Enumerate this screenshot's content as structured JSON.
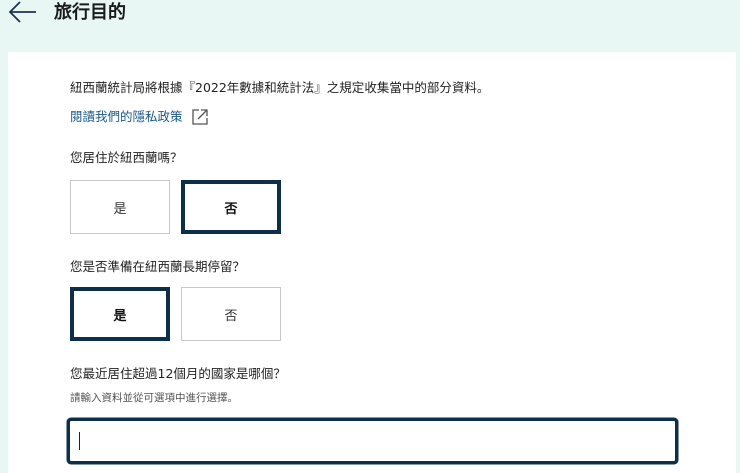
{
  "header": {
    "title": "旅行目的",
    "back_icon": "arrow-left-icon"
  },
  "form": {
    "notice": "紐西蘭統計局將根據『2022年數據和統計法』之規定收集當中的部分資料。",
    "privacy_link": {
      "label": "閱讀我們的隱私政策",
      "icon": "external-link-icon"
    },
    "questions": [
      {
        "label": "您居住於紐西蘭嗎？",
        "options": [
          "是",
          "否"
        ],
        "selected": "否"
      },
      {
        "label": "您是否準備在紐西蘭長期停留？",
        "options": [
          "是",
          "否"
        ],
        "selected": "是"
      }
    ],
    "country_question": {
      "label": "您最近居住超過12個月的國家是哪個？",
      "hint": "請輸入資料並從可選項中進行選擇。",
      "value": ""
    }
  },
  "colors": {
    "header_bg": "#e8f7f3",
    "selected_border": "#0d2f4a",
    "link": "#1b5a8a",
    "unselected_border": "#c8c8c8"
  }
}
